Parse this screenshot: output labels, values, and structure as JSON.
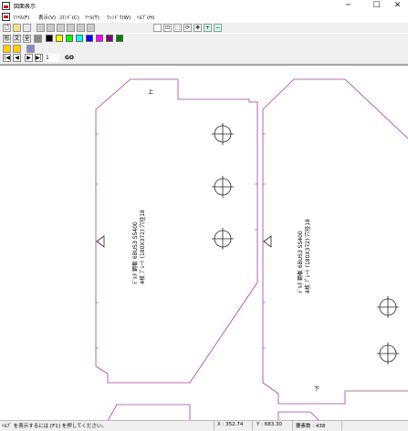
{
  "window": {
    "title": "図面表示",
    "min": "─",
    "max": "☐",
    "close": "✕"
  },
  "menu": [
    {
      "label": "ﾌｧｲﾙ(F)"
    },
    {
      "label": "表示(V)"
    },
    {
      "label": "ｺﾏﾝﾄﾞ(C)"
    },
    {
      "label": "ﾂｰﾙ(T)"
    },
    {
      "label": "ｳｨﾝﾄﾞｳ(W)"
    },
    {
      "label": "ﾍﾙﾌﾟ(H)"
    }
  ],
  "toolbar2": {
    "label_kata": "形",
    "label_bun": "文",
    "label_zen": "全"
  },
  "swatches": [
    "#000000",
    "#ffff00",
    "#00ff00",
    "#00ffff",
    "#0000ff",
    "#ff00ff",
    "#800080",
    "#008000"
  ],
  "nav": {
    "first": "|◀",
    "prev": "◀",
    "next": "▶",
    "last": "▶|",
    "page": "1",
    "go": "GO"
  },
  "drawing": {
    "line_color": "#a040a0",
    "part_left": {
      "line1": "ﾃﾞﾙﾀ 鋼板 6BUS3 SS400",
      "line2": "4枚 ﾌﾟﾚｰﾄ (180X372) 穴径18",
      "mark": "上"
    },
    "part_right": {
      "line1": "ﾃﾞﾙﾀ 鋼板 6BUS3 SS400",
      "line2": "4枚 ﾌﾟﾚｰﾄ (180X372) 穴径18",
      "mark": "下"
    }
  },
  "status": {
    "help": "ﾍﾙﾌﾟ を表示するには [F1] を押してください。",
    "x": "X : 352.74",
    "y": "Y : 683.30",
    "elements": "要素数 : 438"
  }
}
